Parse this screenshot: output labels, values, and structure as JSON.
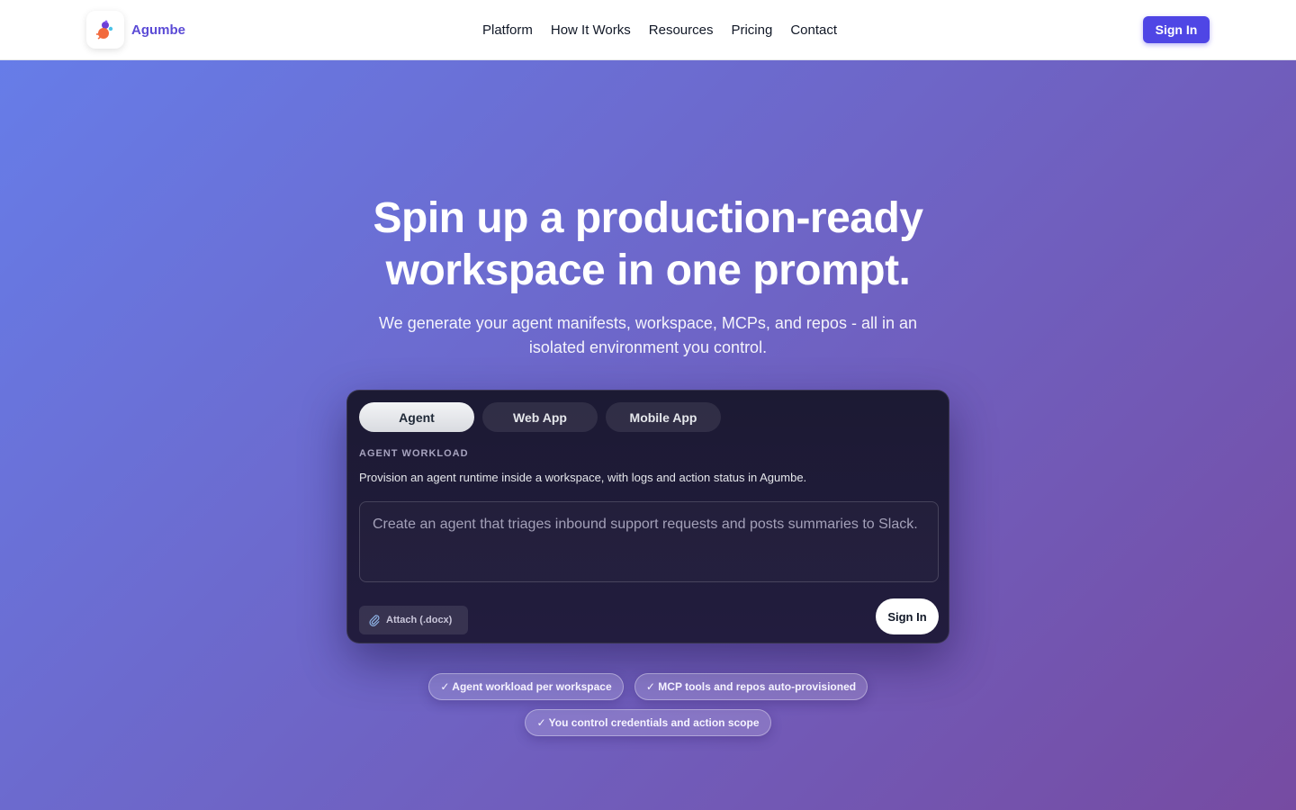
{
  "brand": {
    "name": "Agumbe",
    "logo_icon": "agumbe-logo-icon",
    "colors": {
      "accent": "#4f46e5",
      "brand_text": "#5b4bd6"
    }
  },
  "nav": {
    "items": [
      {
        "label": "Platform"
      },
      {
        "label": "How It Works"
      },
      {
        "label": "Resources"
      },
      {
        "label": "Pricing"
      },
      {
        "label": "Contact"
      }
    ],
    "sign_in_label": "Sign In"
  },
  "hero": {
    "title_line1": "Spin up a production-ready",
    "title_line2": "workspace in one prompt.",
    "subtitle": "We generate your agent manifests, workspace, MCPs, and repos - all in an isolated environment you control."
  },
  "card": {
    "tabs": [
      {
        "label": "Agent",
        "active": true
      },
      {
        "label": "Web App",
        "active": false
      },
      {
        "label": "Mobile App",
        "active": false
      }
    ],
    "section_label": "AGENT WORKLOAD",
    "section_description": "Provision an agent runtime inside a workspace, with logs and action status in Agumbe.",
    "prompt_placeholder": "Create an agent that triages inbound support requests and posts summaries to Slack.",
    "attach_label": "Attach (.docx)",
    "attach_icon": "paperclip-icon",
    "submit_label": "Sign In"
  },
  "features": [
    {
      "label": "✓ Agent workload per workspace"
    },
    {
      "label": "✓ MCP tools and repos auto-provisioned"
    },
    {
      "label": "✓ You control credentials and action scope"
    }
  ]
}
